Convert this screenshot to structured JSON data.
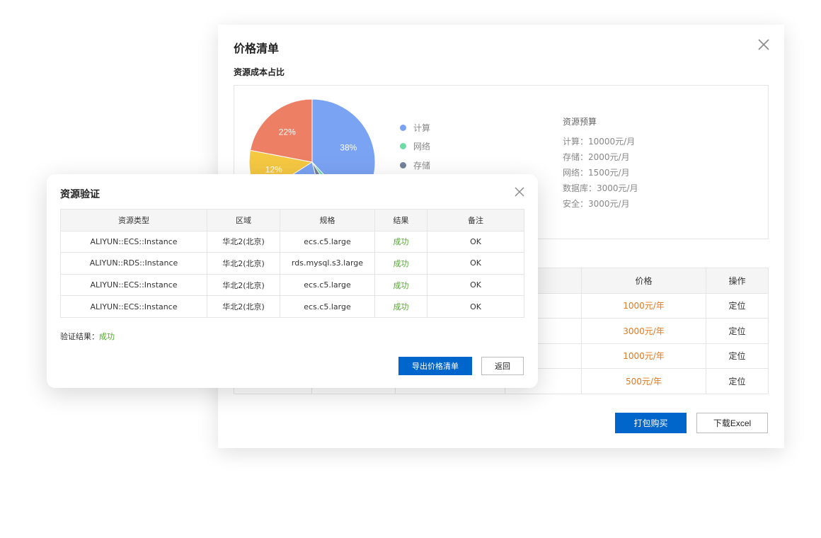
{
  "price_dialog": {
    "title": "价格清单",
    "section_title": "资源成本占比",
    "buttons": {
      "bundle_buy": "打包购买",
      "download_excel": "下载Excel"
    },
    "table": {
      "headers": [
        "价格",
        "操作"
      ],
      "rows": [
        {
          "price": "1000元/年",
          "action": "定位"
        },
        {
          "price": "3000元/年",
          "action": "定位"
        },
        {
          "price": "1000元/年",
          "action": "定位"
        },
        {
          "price": "500元/年",
          "action": "定位"
        }
      ]
    },
    "budget": {
      "title": "资源预算",
      "lines": [
        "计算：10000元/月",
        "存储：2000元/月",
        "网络：1500元/月",
        "数据库：3000元/月",
        "安全：3000元/月"
      ]
    }
  },
  "chart_data": {
    "type": "pie",
    "slices": [
      {
        "label": "计算",
        "value": 38,
        "display": "38%",
        "color": "#7ba3f3"
      },
      {
        "label": "网络",
        "value": 3,
        "display": "",
        "color": "#6fdba9"
      },
      {
        "label": "存储",
        "value": 5,
        "display": "",
        "color": "#74819a"
      },
      {
        "label": "",
        "value": 20,
        "display": "",
        "color": "#7ba3f3"
      },
      {
        "label": "",
        "value": 12,
        "display": "12%",
        "color": "#f5c842"
      },
      {
        "label": "",
        "value": 22,
        "display": "22%",
        "color": "#ec7f64"
      }
    ],
    "legend": [
      {
        "label": "计算",
        "color": "#7ba3f3"
      },
      {
        "label": "网络",
        "color": "#6fdba9"
      },
      {
        "label": "存储",
        "color": "#74819a"
      }
    ]
  },
  "validation_dialog": {
    "title": "资源验证",
    "table": {
      "headers": [
        "资源类型",
        "区域",
        "规格",
        "结果",
        "备注"
      ],
      "rows": [
        {
          "type": "ALIYUN::ECS::Instance",
          "region": "华北2(北京)",
          "spec": "ecs.c5.large",
          "result": "成功",
          "note": "OK"
        },
        {
          "type": "ALIYUN::RDS::Instance",
          "region": "华北2(北京)",
          "spec": "rds.mysql.s3.large",
          "result": "成功",
          "note": "OK"
        },
        {
          "type": "ALIYUN::ECS::Instance",
          "region": "华北2(北京)",
          "spec": "ecs.c5.large",
          "result": "成功",
          "note": "OK"
        },
        {
          "type": "ALIYUN::ECS::Instance",
          "region": "华北2(北京)",
          "spec": "ecs.c5.large",
          "result": "成功",
          "note": "OK"
        }
      ]
    },
    "summary_label": "验证结果：",
    "summary_value": "成功",
    "buttons": {
      "export": "导出价格清单",
      "back": "返回"
    }
  }
}
